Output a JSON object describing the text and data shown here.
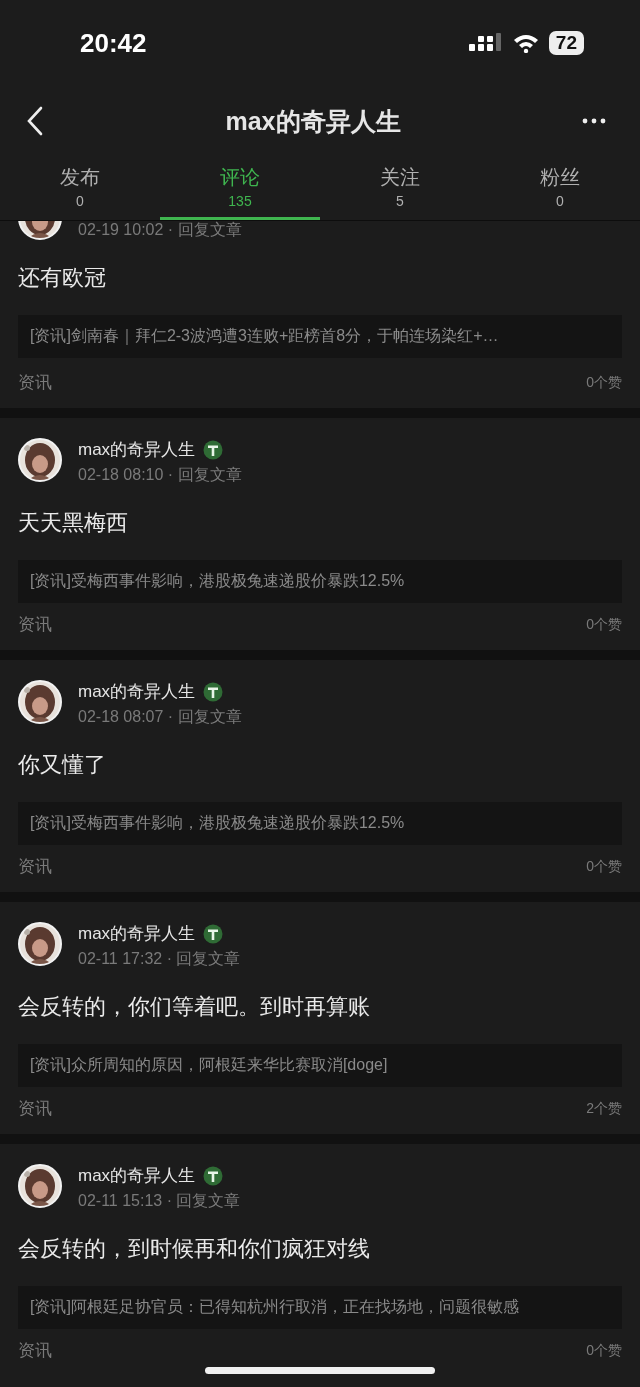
{
  "status_bar": {
    "time": "20:42",
    "battery": "72"
  },
  "nav": {
    "title": "max的奇异人生"
  },
  "tabs": [
    {
      "label": "发布",
      "count": "0",
      "selected": false
    },
    {
      "label": "评论",
      "count": "135",
      "selected": true
    },
    {
      "label": "关注",
      "count": "5",
      "selected": false
    },
    {
      "label": "粉丝",
      "count": "0",
      "selected": false
    }
  ],
  "comments": [
    {
      "time": "02-19 10:02 · 回复文章",
      "text": "还有欧冠",
      "quote": "[资讯]剑南春｜拜仁2-3波鸿遭3连败+距榜首8分，于帕连场染红+…",
      "category": "资讯",
      "likes": "0个赞"
    },
    {
      "author": "max的奇异人生",
      "verified": true,
      "time": "02-18 08:10 · 回复文章",
      "text": "天天黑梅西",
      "quote": "[资讯]受梅西事件影响，港股极兔速递股价暴跌12.5%",
      "category": "资讯",
      "likes": "0个赞"
    },
    {
      "author": "max的奇异人生",
      "verified": true,
      "time": "02-18 08:07 · 回复文章",
      "text": "你又懂了",
      "quote": "[资讯]受梅西事件影响，港股极兔速递股价暴跌12.5%",
      "category": "资讯",
      "likes": "0个赞"
    },
    {
      "author": "max的奇异人生",
      "verified": true,
      "time": "02-11 17:32 · 回复文章",
      "text": "会反转的，你们等着吧。到时再算账",
      "quote": "[资讯]众所周知的原因，阿根廷来华比赛取消[doge]",
      "category": "资讯",
      "likes": "2个赞"
    },
    {
      "author": "max的奇异人生",
      "verified": true,
      "time": "02-11 15:13 · 回复文章",
      "text": "会反转的，到时候再和你们疯狂对线",
      "quote": "[资讯]阿根廷足协官员：已得知杭州行取消，正在找场地，问题很敏感",
      "category": "资讯",
      "likes": "0个赞"
    }
  ]
}
